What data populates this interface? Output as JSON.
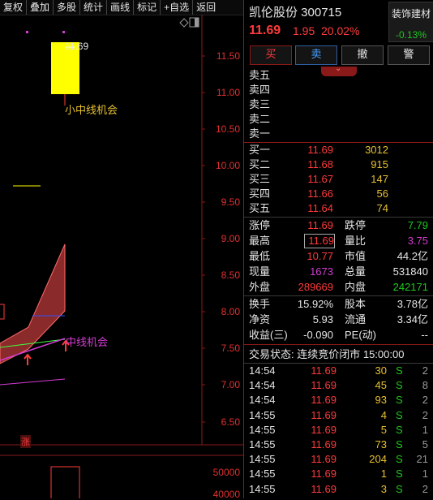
{
  "toolbar": {
    "items": [
      "复权",
      "叠加",
      "多股",
      "统计",
      "画线",
      "标记",
      "+自选",
      "返回"
    ]
  },
  "chart": {
    "price_ticks": [
      "11.50",
      "11.00",
      "10.50",
      "10.00",
      "9.50",
      "9.00",
      "8.50",
      "8.00",
      "7.50",
      "7.00",
      "6.50"
    ],
    "volume_ticks": [
      "50000",
      "40000"
    ],
    "high_label": "11.69",
    "annotation_1": "小中线机会",
    "annotation_2": "中线机会",
    "rise_badge": "涨"
  },
  "header": {
    "name_code": "凯伦股份 300715",
    "sector": "装饰建材",
    "sector_change": "-0.13%",
    "price": "11.69",
    "change": "1.95",
    "change_pct": "20.02%"
  },
  "buttons": {
    "buy": "买",
    "sell": "卖",
    "cancel": "撤",
    "alert": "警"
  },
  "asks": [
    "卖五",
    "卖四",
    "卖三",
    "卖二",
    "卖一"
  ],
  "bids": [
    {
      "label": "买一",
      "price": "11.69",
      "vol": "3012"
    },
    {
      "label": "买二",
      "price": "11.68",
      "vol": "915"
    },
    {
      "label": "买三",
      "price": "11.67",
      "vol": "147"
    },
    {
      "label": "买四",
      "price": "11.66",
      "vol": "56"
    },
    {
      "label": "买五",
      "price": "11.64",
      "vol": "74"
    }
  ],
  "stats": {
    "limit_up_lbl": "涨停",
    "limit_up": "11.69",
    "limit_down_lbl": "跌停",
    "limit_down": "7.79",
    "high_lbl": "最高",
    "high": "11.69",
    "vol_ratio_lbl": "量比",
    "vol_ratio": "3.75",
    "low_lbl": "最低",
    "low": "10.77",
    "mkt_val_lbl": "市值",
    "mkt_val": "44.2亿",
    "cur_vol_lbl": "现量",
    "cur_vol": "1673",
    "total_vol_lbl": "总量",
    "total_vol": "531840",
    "outer_lbl": "外盘",
    "outer": "289669",
    "inner_lbl": "内盘",
    "inner": "242171",
    "turnover_lbl": "换手",
    "turnover": "15.92%",
    "equity_lbl": "股本",
    "equity": "3.78亿",
    "net_asset_lbl": "净资",
    "net_asset": "5.93",
    "float_lbl": "流通",
    "float": "3.34亿",
    "eps_lbl": "收益(三)",
    "eps": "-0.090",
    "pe_lbl": "PE(动)",
    "pe": "--"
  },
  "trade_status": "交易状态: 连续竞价闭市 15:00:00",
  "trades": [
    {
      "time": "14:54",
      "price": "11.69",
      "vol": "30",
      "side": "S",
      "n": "2"
    },
    {
      "time": "14:54",
      "price": "11.69",
      "vol": "45",
      "side": "S",
      "n": "8"
    },
    {
      "time": "14:54",
      "price": "11.69",
      "vol": "93",
      "side": "S",
      "n": "2"
    },
    {
      "time": "14:55",
      "price": "11.69",
      "vol": "4",
      "side": "S",
      "n": "2"
    },
    {
      "time": "14:55",
      "price": "11.69",
      "vol": "5",
      "side": "S",
      "n": "1"
    },
    {
      "time": "14:55",
      "price": "11.69",
      "vol": "73",
      "side": "S",
      "n": "5"
    },
    {
      "time": "14:55",
      "price": "11.69",
      "vol": "204",
      "side": "S",
      "n": "21"
    },
    {
      "time": "14:55",
      "price": "11.69",
      "vol": "1",
      "side": "S",
      "n": "1"
    },
    {
      "time": "14:55",
      "price": "11.69",
      "vol": "3",
      "side": "S",
      "n": "2"
    }
  ],
  "colors": {
    "up": "#ff3b3b",
    "down": "#1ec81e",
    "vol": "#e6c030",
    "magenta": "#d23cd2"
  }
}
